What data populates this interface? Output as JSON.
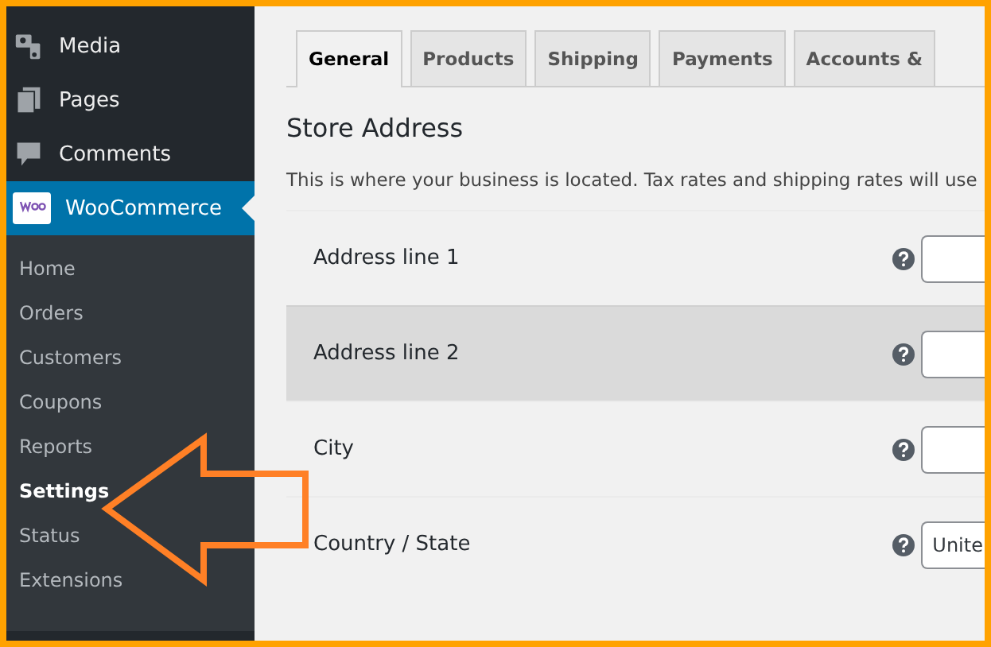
{
  "sidebar": {
    "items": [
      {
        "label": "Media"
      },
      {
        "label": "Pages"
      },
      {
        "label": "Comments"
      }
    ],
    "section": {
      "label": "WooCommerce",
      "current": true
    },
    "submenu": [
      {
        "label": "Home",
        "selected": false
      },
      {
        "label": "Orders",
        "selected": false
      },
      {
        "label": "Customers",
        "selected": false
      },
      {
        "label": "Coupons",
        "selected": false
      },
      {
        "label": "Reports",
        "selected": false
      },
      {
        "label": "Settings",
        "selected": true
      },
      {
        "label": "Status",
        "selected": false
      },
      {
        "label": "Extensions",
        "selected": false
      }
    ]
  },
  "tabs": [
    {
      "label": "General",
      "selected": true
    },
    {
      "label": "Products",
      "selected": false
    },
    {
      "label": "Shipping",
      "selected": false
    },
    {
      "label": "Payments",
      "selected": false
    },
    {
      "label": "Accounts &",
      "selected": false
    }
  ],
  "heading": "Store Address",
  "description": "This is where your business is located. Tax rates and shipping rates will use",
  "fields": [
    {
      "label": "Address line 1",
      "highlighted": false,
      "kind": "text"
    },
    {
      "label": "Address line 2",
      "highlighted": true,
      "kind": "text"
    },
    {
      "label": "City",
      "highlighted": false,
      "kind": "text"
    },
    {
      "label": "Country / State",
      "highlighted": false,
      "kind": "select",
      "value": "Unite"
    }
  ]
}
